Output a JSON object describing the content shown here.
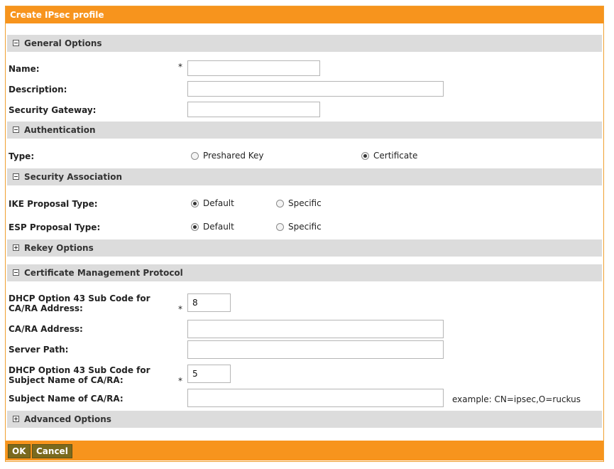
{
  "title": "Create IPsec profile",
  "sections": {
    "general": "General Options",
    "auth": "Authentication",
    "sa": "Security Association",
    "rekey": "Rekey Options",
    "cmp": "Certificate Management Protocol",
    "advanced": "Advanced Options"
  },
  "fields": {
    "name": {
      "label": "Name:",
      "value": ""
    },
    "description": {
      "label": "Description:",
      "value": ""
    },
    "security_gateway": {
      "label": "Security Gateway:",
      "value": ""
    },
    "type": {
      "label": "Type:",
      "options": [
        "Preshared Key",
        "Certificate"
      ],
      "selected": "Certificate"
    },
    "ike": {
      "label": "IKE Proposal Type:",
      "options": [
        "Default",
        "Specific"
      ],
      "selected": "Default"
    },
    "esp": {
      "label": "ESP Proposal Type:",
      "options": [
        "Default",
        "Specific"
      ],
      "selected": "Default"
    },
    "dhcp_ca": {
      "label_line1": "DHCP Option 43 Sub Code for",
      "label_line2": "CA/RA Address:",
      "value": "8"
    },
    "ca_address": {
      "label": "CA/RA Address:",
      "value": ""
    },
    "server_path": {
      "label": "Server Path:",
      "value": ""
    },
    "dhcp_subject": {
      "label_line1": "DHCP Option 43 Sub Code for",
      "label_line2": "Subject Name of CA/RA:",
      "value": "5"
    },
    "subject_name": {
      "label": "Subject Name of CA/RA:",
      "value": "",
      "example": "example: CN=ipsec,O=ruckus"
    }
  },
  "required_marker": "*",
  "buttons": {
    "ok": "OK",
    "cancel": "Cancel"
  },
  "colors": {
    "accent": "#f7941d",
    "section_bg": "#dcdcdc",
    "button_bg": "#7a6a1e"
  }
}
